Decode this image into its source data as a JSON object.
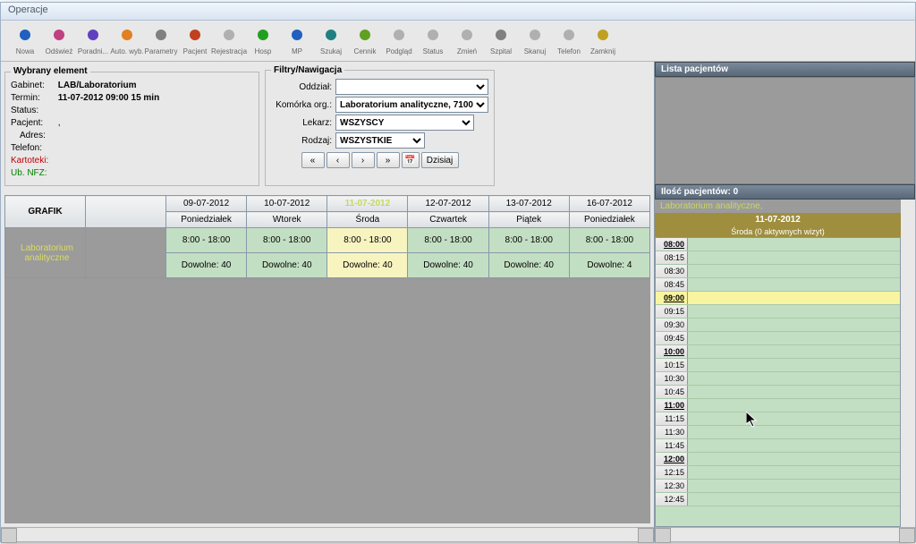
{
  "window": {
    "title": "Operacje"
  },
  "toolbar": [
    {
      "id": "nowa",
      "label": "Nowa",
      "color": "#2060c0"
    },
    {
      "id": "odswiez",
      "label": "Odśwież",
      "color": "#c04080"
    },
    {
      "id": "poradnie",
      "label": "Poradni...",
      "color": "#6040c0"
    },
    {
      "id": "autowyb",
      "label": "Auto. wyb.",
      "color": "#e08020"
    },
    {
      "id": "parametry",
      "label": "Parametry",
      "color": "#808080"
    },
    {
      "id": "pacjent",
      "label": "Pacjent",
      "color": "#c04020"
    },
    {
      "id": "rejestracja",
      "label": "Rejestracja",
      "color": "#b0b0b0"
    },
    {
      "id": "hosp",
      "label": "Hosp",
      "color": "#20a020"
    },
    {
      "id": "mp",
      "label": "MP",
      "color": "#2060c0"
    },
    {
      "id": "szukaj",
      "label": "Szukaj",
      "color": "#208080"
    },
    {
      "id": "cennik",
      "label": "Cennik",
      "color": "#60a020"
    },
    {
      "id": "podglad",
      "label": "Podgląd",
      "color": "#b0b0b0"
    },
    {
      "id": "status",
      "label": "Status",
      "color": "#b0b0b0"
    },
    {
      "id": "zmien",
      "label": "Zmień",
      "color": "#b0b0b0"
    },
    {
      "id": "szpital",
      "label": "Szpital",
      "color": "#808080"
    },
    {
      "id": "skanuj",
      "label": "Skanuj",
      "color": "#b0b0b0"
    },
    {
      "id": "telefon",
      "label": "Telefon",
      "color": "#b0b0b0"
    },
    {
      "id": "zamknij",
      "label": "Zamknij",
      "color": "#c0a020"
    }
  ],
  "wybrany": {
    "title": "Wybrany element",
    "gabinet_lbl": "Gabinet:",
    "gabinet": "LAB/Laboratorium",
    "termin_lbl": "Termin:",
    "termin": "11-07-2012    09:00        15  min",
    "status_lbl": "Status:",
    "pacjent_lbl": "Pacjent:",
    "pacjent": ",",
    "adres_lbl": "Adres:",
    "telefon_lbl": "Telefon:",
    "kartoteki_lbl": "Kartoteki:",
    "ubnfz_lbl": "Ub. NFZ:"
  },
  "filtry": {
    "title": "Filtry/Nawigacja",
    "oddzial_lbl": "Oddział:",
    "oddzial_val": "",
    "komorka_lbl": "Komórka org.:",
    "komorka_val": "Laboratorium analityczne, 7100",
    "lekarz_lbl": "Lekarz:",
    "lekarz_val": "WSZYSCY",
    "rodzaj_lbl": "Rodzaj:",
    "rodzaj_val": "WSZYSTKIE",
    "prev2": "«",
    "prev": "‹",
    "next": "›",
    "next2": "»",
    "dzisiaj": "Dzisiaj"
  },
  "grid": {
    "grafik": "GRAFIK",
    "days": [
      {
        "date": "09-07-2012",
        "name": "Poniedziałek",
        "hours": "8:00 - 18:00",
        "free": "Dowolne: 40"
      },
      {
        "date": "10-07-2012",
        "name": "Wtorek",
        "hours": "8:00 - 18:00",
        "free": "Dowolne: 40"
      },
      {
        "date": "11-07-2012",
        "name": "Środa",
        "hours": "8:00 - 18:00",
        "free": "Dowolne: 40",
        "selected": true
      },
      {
        "date": "12-07-2012",
        "name": "Czwartek",
        "hours": "8:00 - 18:00",
        "free": "Dowolne: 40"
      },
      {
        "date": "13-07-2012",
        "name": "Piątek",
        "hours": "8:00 - 18:00",
        "free": "Dowolne: 40"
      },
      {
        "date": "16-07-2012",
        "name": "Poniedziałek",
        "hours": "8:00 - 18:00",
        "free": "Dowolne: 4"
      }
    ],
    "rowlabel1": "Laboratorium",
    "rowlabel2": "analityczne",
    "rowlabel_sub": ""
  },
  "lista": {
    "title": "Lista pacjentów",
    "count": "Ilość pacjentów: 0",
    "lab": "Laboratorium analityczne,",
    "date": "11-07-2012",
    "sub": "Środa (0 aktywnych wizyt)"
  },
  "slots": [
    {
      "t": "08:00",
      "hour": true
    },
    {
      "t": "08:15"
    },
    {
      "t": "08:30"
    },
    {
      "t": "08:45"
    },
    {
      "t": "09:00",
      "hour": true,
      "sel": true
    },
    {
      "t": "09:15"
    },
    {
      "t": "09:30"
    },
    {
      "t": "09:45"
    },
    {
      "t": "10:00",
      "hour": true
    },
    {
      "t": "10:15"
    },
    {
      "t": "10:30"
    },
    {
      "t": "10:45"
    },
    {
      "t": "11:00",
      "hour": true
    },
    {
      "t": "11:15"
    },
    {
      "t": "11:30"
    },
    {
      "t": "11:45"
    },
    {
      "t": "12:00",
      "hour": true
    },
    {
      "t": "12:15"
    },
    {
      "t": "12:30"
    },
    {
      "t": "12:45"
    }
  ]
}
